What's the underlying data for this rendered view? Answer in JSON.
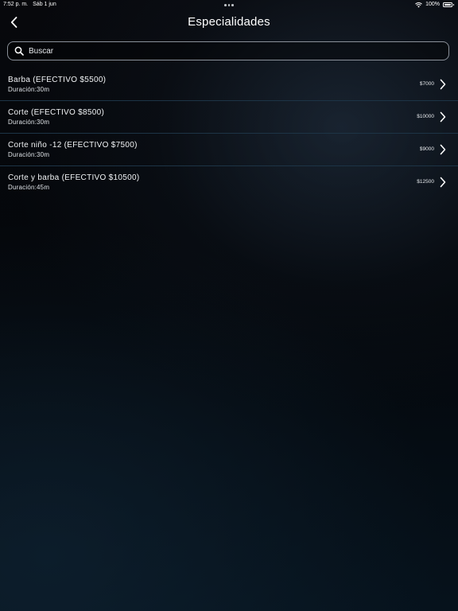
{
  "status_bar": {
    "time": "7:52 p. m.",
    "date": "Sáb 1 jun",
    "battery": "100%",
    "icons": [
      "wifi-icon",
      "battery-icon"
    ]
  },
  "nav": {
    "title": "Especialidades",
    "back_icon": "chevron-left-icon"
  },
  "search": {
    "placeholder": "Buscar",
    "value": "",
    "icon": "search-icon"
  },
  "items": [
    {
      "name": "Barba (EFECTIVO $5500)",
      "duration": "Duración:30m",
      "price": "$7000"
    },
    {
      "name": "Corte (EFECTIVO $8500)",
      "duration": "Duración:30m",
      "price": "$10000"
    },
    {
      "name": "Corte niño -12 (EFECTIVO $7500)",
      "duration": "Duración:30m",
      "price": "$9000"
    },
    {
      "name": "Corte y barba (EFECTIVO $10500)",
      "duration": "Duración:45m",
      "price": "$12500"
    }
  ],
  "colors": {
    "background": "#05080c",
    "separator": "#1d3446",
    "search_border": "#8a9099",
    "text": "#ffffff"
  }
}
